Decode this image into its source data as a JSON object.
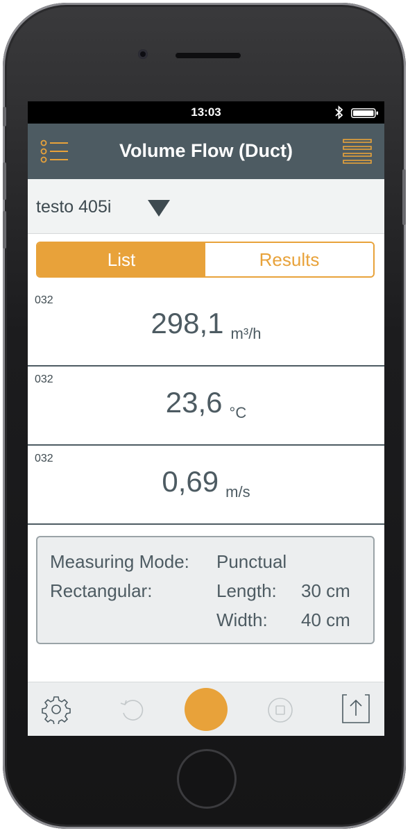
{
  "status": {
    "time": "13:03"
  },
  "header": {
    "title": "Volume Flow (Duct)"
  },
  "device": {
    "name": "testo 405i"
  },
  "tabs": [
    {
      "label": "List",
      "active": true
    },
    {
      "label": "Results",
      "active": false
    }
  ],
  "readings": [
    {
      "id": "032",
      "value": "298,1",
      "unit": "m³/h"
    },
    {
      "id": "032",
      "value": "23,6",
      "unit": "°C"
    },
    {
      "id": "032",
      "value": "0,69",
      "unit": "m/s"
    }
  ],
  "info": {
    "mode_label": "Measuring Mode:",
    "mode_value": "Punctual",
    "shape_label": "Rectangular:",
    "length_label": "Length:",
    "length_value": "30 cm",
    "width_label": "Width:",
    "width_value": "40 cm"
  },
  "toolbar": {
    "icons": [
      "gear-icon",
      "undo-icon",
      "record-button",
      "stop-icon",
      "share-icon"
    ]
  },
  "colors": {
    "accent": "#e8a23a",
    "header": "#4d5b62",
    "panel": "#eceeef"
  }
}
